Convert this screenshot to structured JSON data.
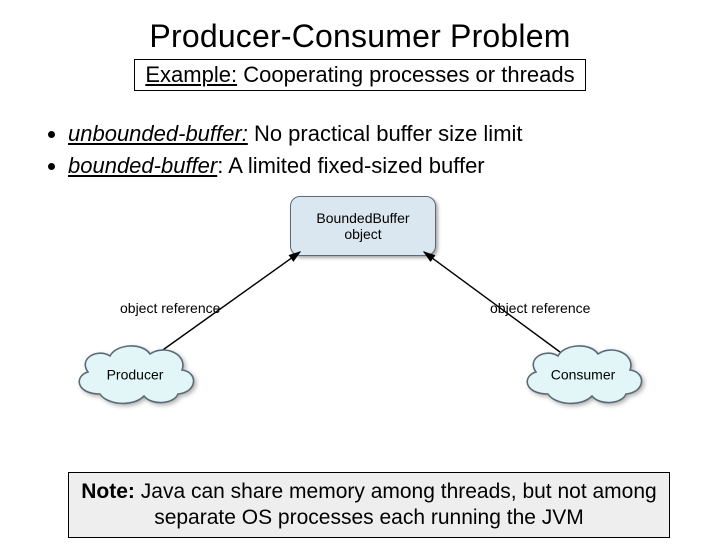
{
  "title": "Producer-Consumer Problem",
  "subtitle": {
    "label": "Example:",
    "text": " Cooperating processes or threads"
  },
  "bullets": [
    {
      "term": "unbounded-buffer:",
      "rest": " No practical buffer size limit"
    },
    {
      "term": "bounded-buffer",
      "rest": ": A limited fixed-sized buffer"
    }
  ],
  "diagram": {
    "bounded_buffer": {
      "line1": "BoundedBuffer",
      "line2": "object"
    },
    "ref_label_left": "object reference",
    "ref_label_right": "object reference",
    "producer": "Producer",
    "consumer": "Consumer",
    "colors": {
      "box_fill": "#dbe7f0",
      "cloud_fill": "#e3f6f7",
      "cloud_stroke": "#5a6b78"
    }
  },
  "note": {
    "label": "Note:",
    "text": " Java can share memory among threads, but not among separate OS processes each running the JVM"
  }
}
